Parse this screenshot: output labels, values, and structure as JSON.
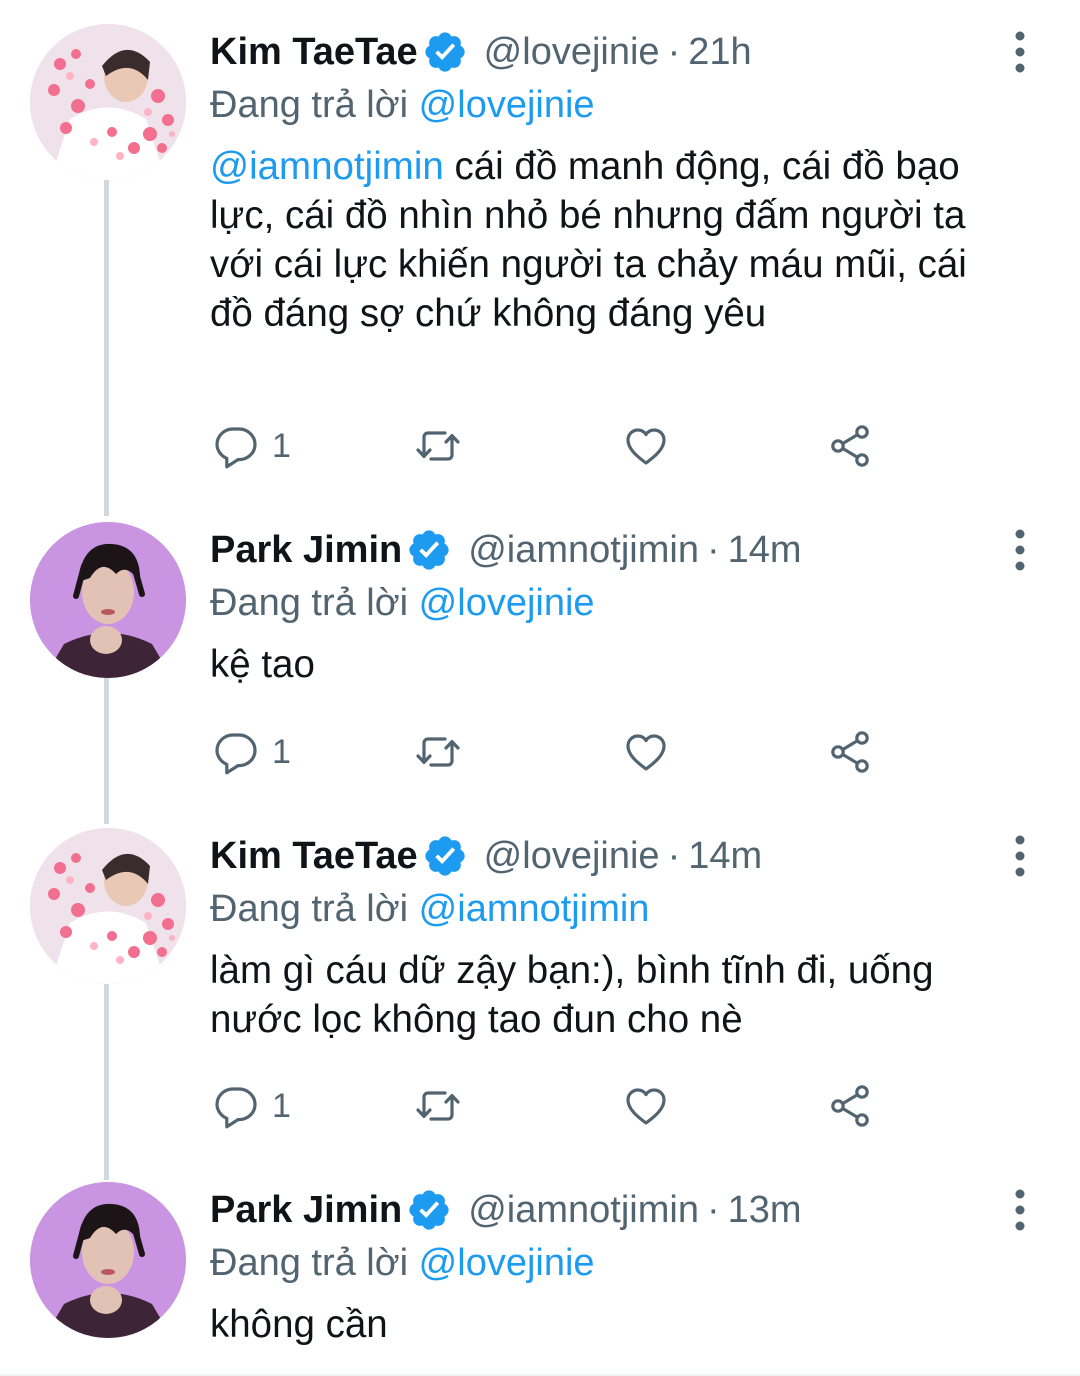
{
  "colors": {
    "link": "#1d9bf0",
    "secondary": "#536471",
    "text": "#0f1419",
    "thread_line": "#cfd9de",
    "verified": "#1d9bf0"
  },
  "icons": {
    "verified": "verified-badge-icon",
    "more": "more-vertical-icon",
    "reply": "reply-icon",
    "retweet": "retweet-icon",
    "like": "heart-icon",
    "share": "share-icon"
  },
  "reply_prefix": "Đang trả lời",
  "tweets": [
    {
      "name": "Kim TaeTae",
      "handle": "@lovejinie",
      "time": "21h",
      "reply_to": "@lovejinie",
      "mention": "@iamnotjimin",
      "text": " cái đồ manh động, cái đồ bạo lực, cái đồ nhìn nhỏ bé nhưng đấm người ta với cái lực khiến người ta chảy máu mũi, cái đồ đáng sợ chứ không đáng yêu",
      "reply_count": "1"
    },
    {
      "name": "Park Jimin",
      "handle": "@iamnotjimin",
      "time": "14m",
      "reply_to": "@lovejinie",
      "text": "kệ tao",
      "reply_count": "1"
    },
    {
      "name": "Kim TaeTae",
      "handle": "@lovejinie",
      "time": "14m",
      "reply_to": "@iamnotjimin",
      "text": "làm gì cáu dữ zậy bạn:), bình tĩnh đi, uống nước lọc không tao đun cho nè",
      "reply_count": "1"
    },
    {
      "name": "Park Jimin",
      "handle": "@iamnotjimin",
      "time": "13m",
      "reply_to": "@lovejinie",
      "text": "không cần"
    }
  ]
}
